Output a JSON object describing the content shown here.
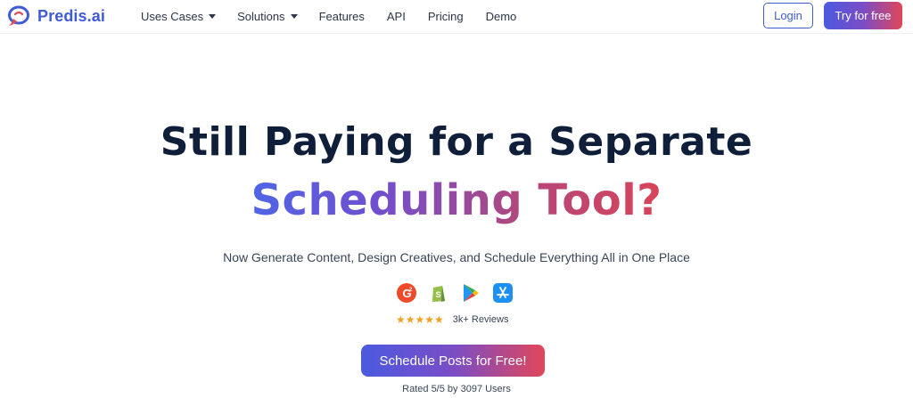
{
  "brand": {
    "name": "Predis.ai",
    "color": "#3f5bd6"
  },
  "nav": {
    "items": [
      {
        "label": "Uses Cases",
        "has_dropdown": true
      },
      {
        "label": "Solutions",
        "has_dropdown": true
      },
      {
        "label": "Features",
        "has_dropdown": false
      },
      {
        "label": "API",
        "has_dropdown": false
      },
      {
        "label": "Pricing",
        "has_dropdown": false
      },
      {
        "label": "Demo",
        "has_dropdown": false
      }
    ],
    "login_label": "Login",
    "try_label": "Try for free"
  },
  "hero": {
    "headline_line1": "Still Paying for a Separate",
    "headline_line2": "Scheduling Tool?",
    "subheadline": "Now Generate Content, Design Creatives, and Schedule Everything All in One Place",
    "badges": [
      "g2-icon",
      "shopify-icon",
      "google-play-icon",
      "app-store-icon"
    ],
    "stars": "★★★★★",
    "rating_value": 5,
    "reviews_label": "3k+ Reviews",
    "cta_label": "Schedule Posts for Free!",
    "rated_text": "Rated 5/5 by 3097 Users"
  },
  "colors": {
    "gradient_start": "#4b5ae0",
    "gradient_mid": "#7a4dc6",
    "gradient_end": "#e0475a",
    "heading": "#0f1f3a",
    "star": "#f3a126"
  }
}
